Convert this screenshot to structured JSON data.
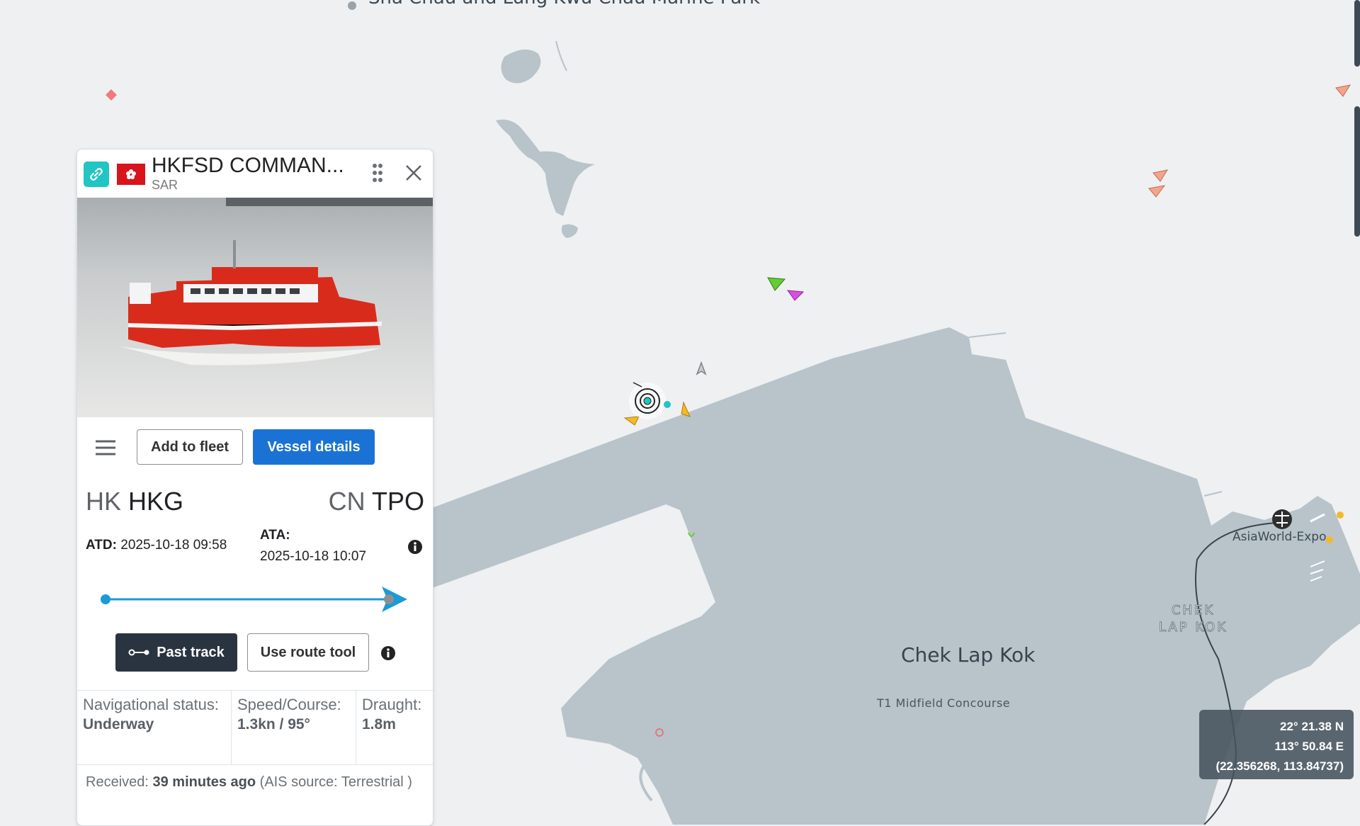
{
  "map": {
    "labels": {
      "park": "Sha Chau and Lung Kwu Chau Marine Park",
      "island": "Chek Lap Kok",
      "terminal": "T1 Midfield Concourse",
      "district_line1": "CHEK",
      "district_line2": "LAP KOK",
      "station": "AsiaWorld-Expo"
    },
    "coordinates": {
      "lat": "22° 21.38 N",
      "lon": "113° 50.84 E",
      "decimal": "(22.356268, 113.84737)"
    },
    "colors": {
      "water": "#eef0f2",
      "land": "#b8c3ca"
    }
  },
  "vessel_panel": {
    "name": "HKFSD COMMAN...",
    "type": "SAR",
    "flag": "HK",
    "icons": {
      "link": "link-icon",
      "drag": "drag-handle-icon",
      "close": "close-icon",
      "menu": "menu-icon",
      "info": "info-icon",
      "track": "past-track-icon"
    },
    "buttons": {
      "add_fleet": "Add to fleet",
      "details": "Vessel details",
      "past_track": "Past track",
      "route_tool": "Use route tool"
    },
    "route": {
      "from_country": "HK",
      "from_port": "HKG",
      "to_country": "CN",
      "to_port": "TPO",
      "atd_label": "ATD:",
      "atd_value": "2025-10-18 09:58",
      "ata_label": "ATA:",
      "ata_value": "2025-10-18 10:07",
      "progress": 1.0
    },
    "stats": {
      "nav_label": "Navigational status:",
      "nav_value": "Underway",
      "speed_label": "Speed/Course:",
      "speed_value": "1.3kn / 95°",
      "draught_label": "Draught:",
      "draught_value": "1.8m"
    },
    "received": {
      "prefix": "Received:",
      "time": "39 minutes ago",
      "source": "(AIS source: Terrestrial )"
    },
    "colors": {
      "primary": "#1a73d4",
      "dark": "#2a3441",
      "accent": "#21c5c3",
      "route": "#1a9ad6"
    }
  }
}
